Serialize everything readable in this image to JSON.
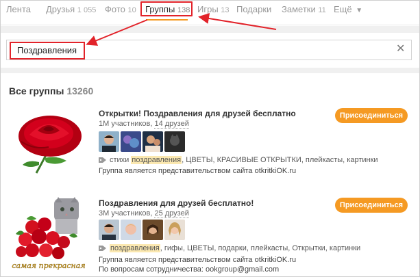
{
  "nav": {
    "items": [
      {
        "label": "Лента",
        "count": ""
      },
      {
        "label": "Друзья",
        "count": "1 055"
      },
      {
        "label": "Фото",
        "count": "10"
      },
      {
        "label": "Группы",
        "count": "138"
      },
      {
        "label": "Игры",
        "count": "13"
      },
      {
        "label": "Подарки",
        "count": ""
      },
      {
        "label": "Заметки",
        "count": "11"
      },
      {
        "label": "Ещё",
        "count": ""
      }
    ]
  },
  "search": {
    "value": "Поздравления",
    "clear_icon": "close-icon"
  },
  "results": {
    "title": "Все группы",
    "count": "13260",
    "groups": [
      {
        "name": "Открытки! Поздравления для друзей бесплатно",
        "members": "1M участников,",
        "friends": "14 друзей",
        "join_label": "Присоединиться",
        "tag_prefix": "стихи",
        "tag_highlight": "поздравления",
        "tag_rest": ", ЦВЕТЫ, КРАСИВЫЕ ОТКРЫТКИ, плейкасты, картинки",
        "description": "Группа является представительством сайта otkritkiOK.ru",
        "extra": ""
      },
      {
        "name": "Поздравления для друзей бесплатно!",
        "members": "3M участников,",
        "friends": "25 друзей",
        "join_label": "Присоединиться",
        "tag_prefix": "",
        "tag_highlight": "поздравления",
        "tag_rest": ", гифы, ЦВЕТЫ, подарки, плейкасты, Открытки, картинки",
        "description": "Группа является представительством сайта otkritkiOK.ru",
        "extra": "По вопросам сотрудничества: ookgroup@gmail.com"
      }
    ],
    "thumb2_caption": "самая прекрасная"
  },
  "colors": {
    "accent": "#f59a23",
    "annotation": "#e2232a"
  }
}
